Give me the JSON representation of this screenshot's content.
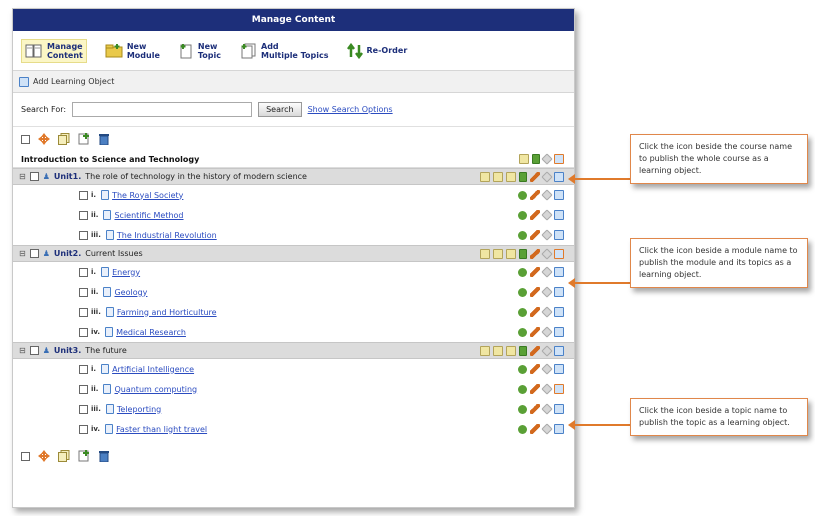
{
  "window": {
    "title": "Manage Content"
  },
  "toolbar": {
    "items": [
      {
        "label": "Manage\nContent",
        "icon": "book-icon"
      },
      {
        "label": "New\nModule",
        "icon": "folder-icon"
      },
      {
        "label": "New\nTopic",
        "icon": "document-icon"
      },
      {
        "label": "Add\nMultiple Topics",
        "icon": "documents-icon"
      },
      {
        "label": "Re-Order",
        "icon": "reorder-icon"
      }
    ]
  },
  "add_learning_object": "Add Learning Object",
  "search": {
    "label": "Search For:",
    "value": "",
    "button": "Search",
    "options_link": "Show Search Options"
  },
  "course": {
    "title": "Introduction to Science and Technology"
  },
  "units": [
    {
      "number": "Unit1.",
      "title": "The role of technology in the history of modern science",
      "topics": [
        {
          "numeral": "i.",
          "title": "The Royal Society"
        },
        {
          "numeral": "ii.",
          "title": "Scientific Method"
        },
        {
          "numeral": "iii.",
          "title": "The Industrial Revolution"
        }
      ]
    },
    {
      "number": "Unit2.",
      "title": "Current Issues",
      "topics": [
        {
          "numeral": "i.",
          "title": "Energy"
        },
        {
          "numeral": "ii.",
          "title": "Geology"
        },
        {
          "numeral": "iii.",
          "title": "Farming and Horticulture"
        },
        {
          "numeral": "iv.",
          "title": "Medical Research"
        }
      ]
    },
    {
      "number": "Unit3.",
      "title": "The future",
      "topics": [
        {
          "numeral": "i.",
          "title": "Artificial Intelligence"
        },
        {
          "numeral": "ii.",
          "title": "Quantum computing"
        },
        {
          "numeral": "iii.",
          "title": "Teleporting"
        },
        {
          "numeral": "iv.",
          "title": "Faster than light travel"
        }
      ]
    }
  ],
  "callouts": {
    "course": "Click the icon beside the course name to publish the whole course as a learning object.",
    "module": "Click the icon beside a module name to publish the module and its topics as a learning object.",
    "topic": "Click the icon beside a topic name to publish the topic as a learning object."
  },
  "colors": {
    "title_bar": "#1d2f7a",
    "accent": "#e07a2b",
    "link": "#2b4cc0"
  }
}
